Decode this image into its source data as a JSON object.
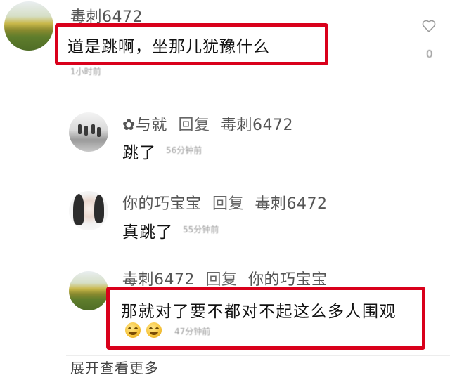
{
  "comments": [
    {
      "user": "毒刺6472",
      "text": "道是跳啊，坐那儿犹豫什么",
      "time": "1小时前",
      "like_count": "0",
      "highlighted": true
    }
  ],
  "replies": [
    {
      "user": "✿与就",
      "reply_word": "回复",
      "reply_to": "毒刺6472",
      "text": "跳了",
      "time": "56分钟前"
    },
    {
      "user": "你的巧宝宝",
      "reply_word": "回复",
      "reply_to": "毒刺6472",
      "text": "真跳了",
      "time": "55分钟前"
    },
    {
      "user": "毒刺6472",
      "reply_word": "回复",
      "reply_to": "你的巧宝宝",
      "text": "那就对了要不都对不起这么多人围观",
      "time": "47分钟前",
      "emojis": [
        "laugh-cry-emoji",
        "laugh-cry-emoji"
      ],
      "highlighted": true
    }
  ],
  "expand_more": "展开查看更多",
  "colors": {
    "highlight": "#d9001b",
    "username": "#555555",
    "time": "#9a9a9a",
    "text": "#111111"
  },
  "icons": {
    "like": "heart-outline-icon"
  }
}
